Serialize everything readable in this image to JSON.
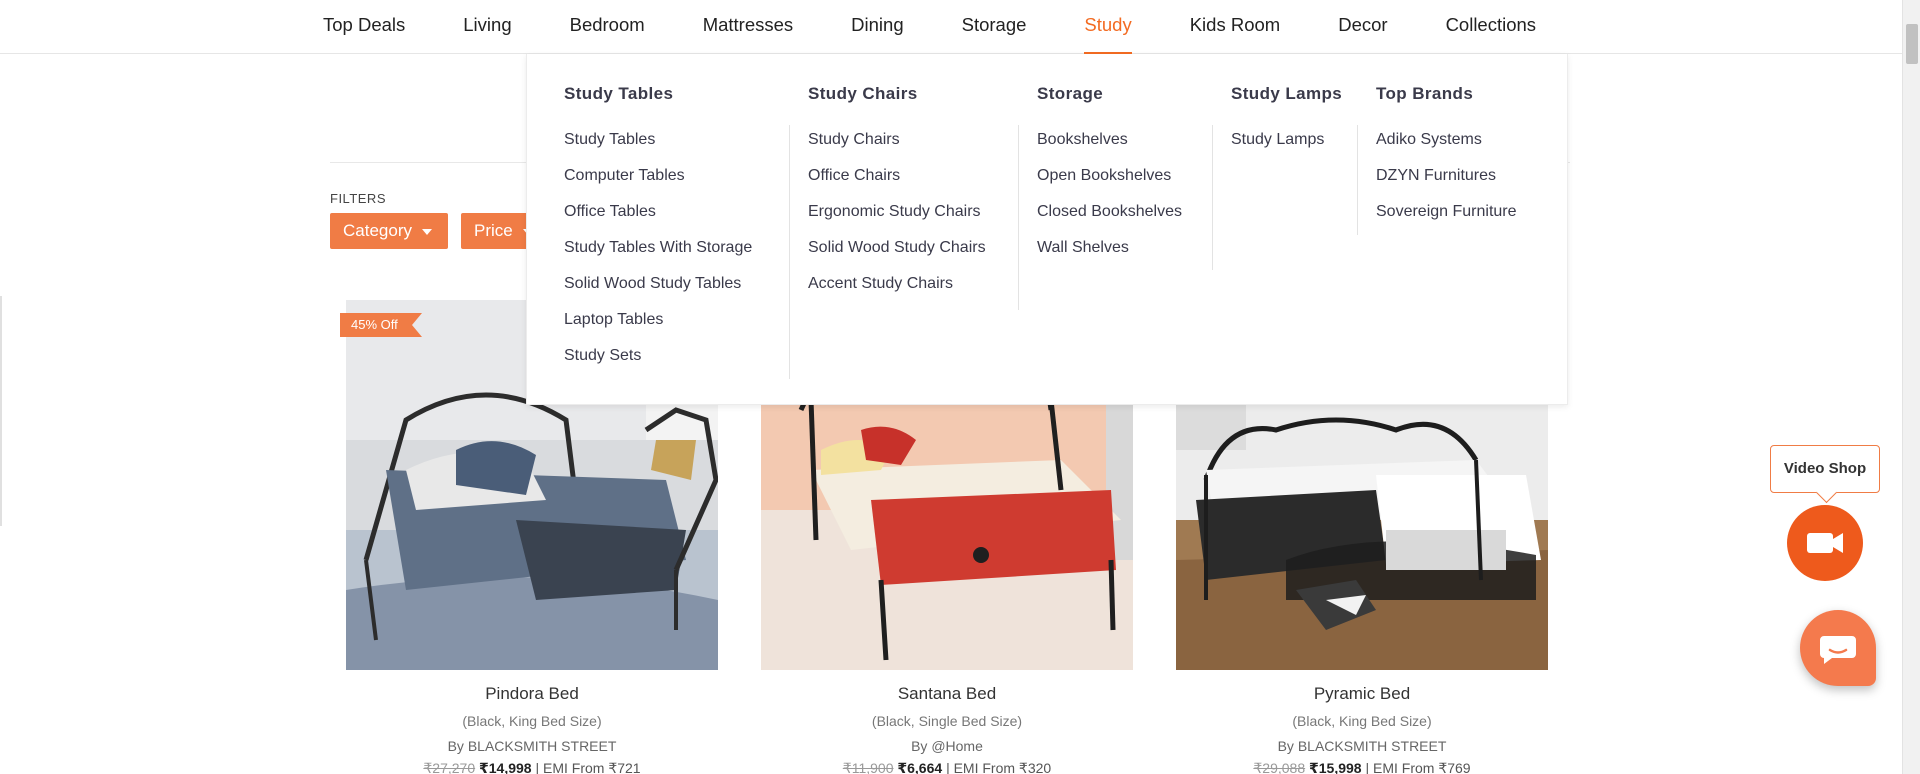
{
  "nav": {
    "items": [
      "Top Deals",
      "Living",
      "Bedroom",
      "Mattresses",
      "Dining",
      "Storage",
      "Study",
      "Kids Room",
      "Decor",
      "Collections"
    ],
    "active": "Study"
  },
  "mega_menu": {
    "study_tables": {
      "title": "Study Tables",
      "items": [
        "Study Tables",
        "Computer Tables",
        "Office Tables",
        "Study Tables With Storage",
        "Solid Wood Study Tables",
        "Laptop Tables",
        "Study Sets"
      ]
    },
    "study_chairs": {
      "title": "Study Chairs",
      "items": [
        "Study Chairs",
        "Office Chairs",
        "Ergonomic Study Chairs",
        "Solid Wood Study Chairs",
        "Accent Study Chairs"
      ]
    },
    "storage": {
      "title": "Storage",
      "items": [
        "Bookshelves",
        "Open Bookshelves",
        "Closed Bookshelves",
        "Wall Shelves"
      ]
    },
    "study_lamps": {
      "title": "Study Lamps",
      "items": [
        "Study Lamps"
      ]
    },
    "top_brands": {
      "title": "Top Brands",
      "items": [
        "Adiko Systems",
        "DZYN Furnitures",
        "Sovereign Furniture"
      ]
    }
  },
  "filters": {
    "label": "FILTERS",
    "category": "Category",
    "price": "Price"
  },
  "products": [
    {
      "name": "Pindora Bed",
      "variant": "(Black, King Bed Size)",
      "brand": "By BLACKSMITH STREET",
      "mrp": "₹27,270",
      "price": "₹14,998",
      "emi": "| EMI From ₹721",
      "discount": "45% Off"
    },
    {
      "name": "Santana Bed",
      "variant": "(Black, Single Bed Size)",
      "brand": "By @Home",
      "mrp": "₹11,900",
      "price": "₹6,664",
      "emi": "| EMI From ₹320"
    },
    {
      "name": "Pyramic Bed",
      "variant": "(Black, King Bed Size)",
      "brand": "By BLACKSMITH STREET",
      "mrp": "₹29,088",
      "price": "₹15,998",
      "emi": "| EMI From ₹769"
    }
  ],
  "video_shop": {
    "label": "Video Shop"
  },
  "colors": {
    "accent": "#f36b22",
    "filter_button": "#f07c45",
    "video_button": "#ee5a1c",
    "chat_button": "#f47a4d"
  },
  "icons": {
    "video": "video-camera-icon",
    "chat": "chat-bubble-icon"
  }
}
